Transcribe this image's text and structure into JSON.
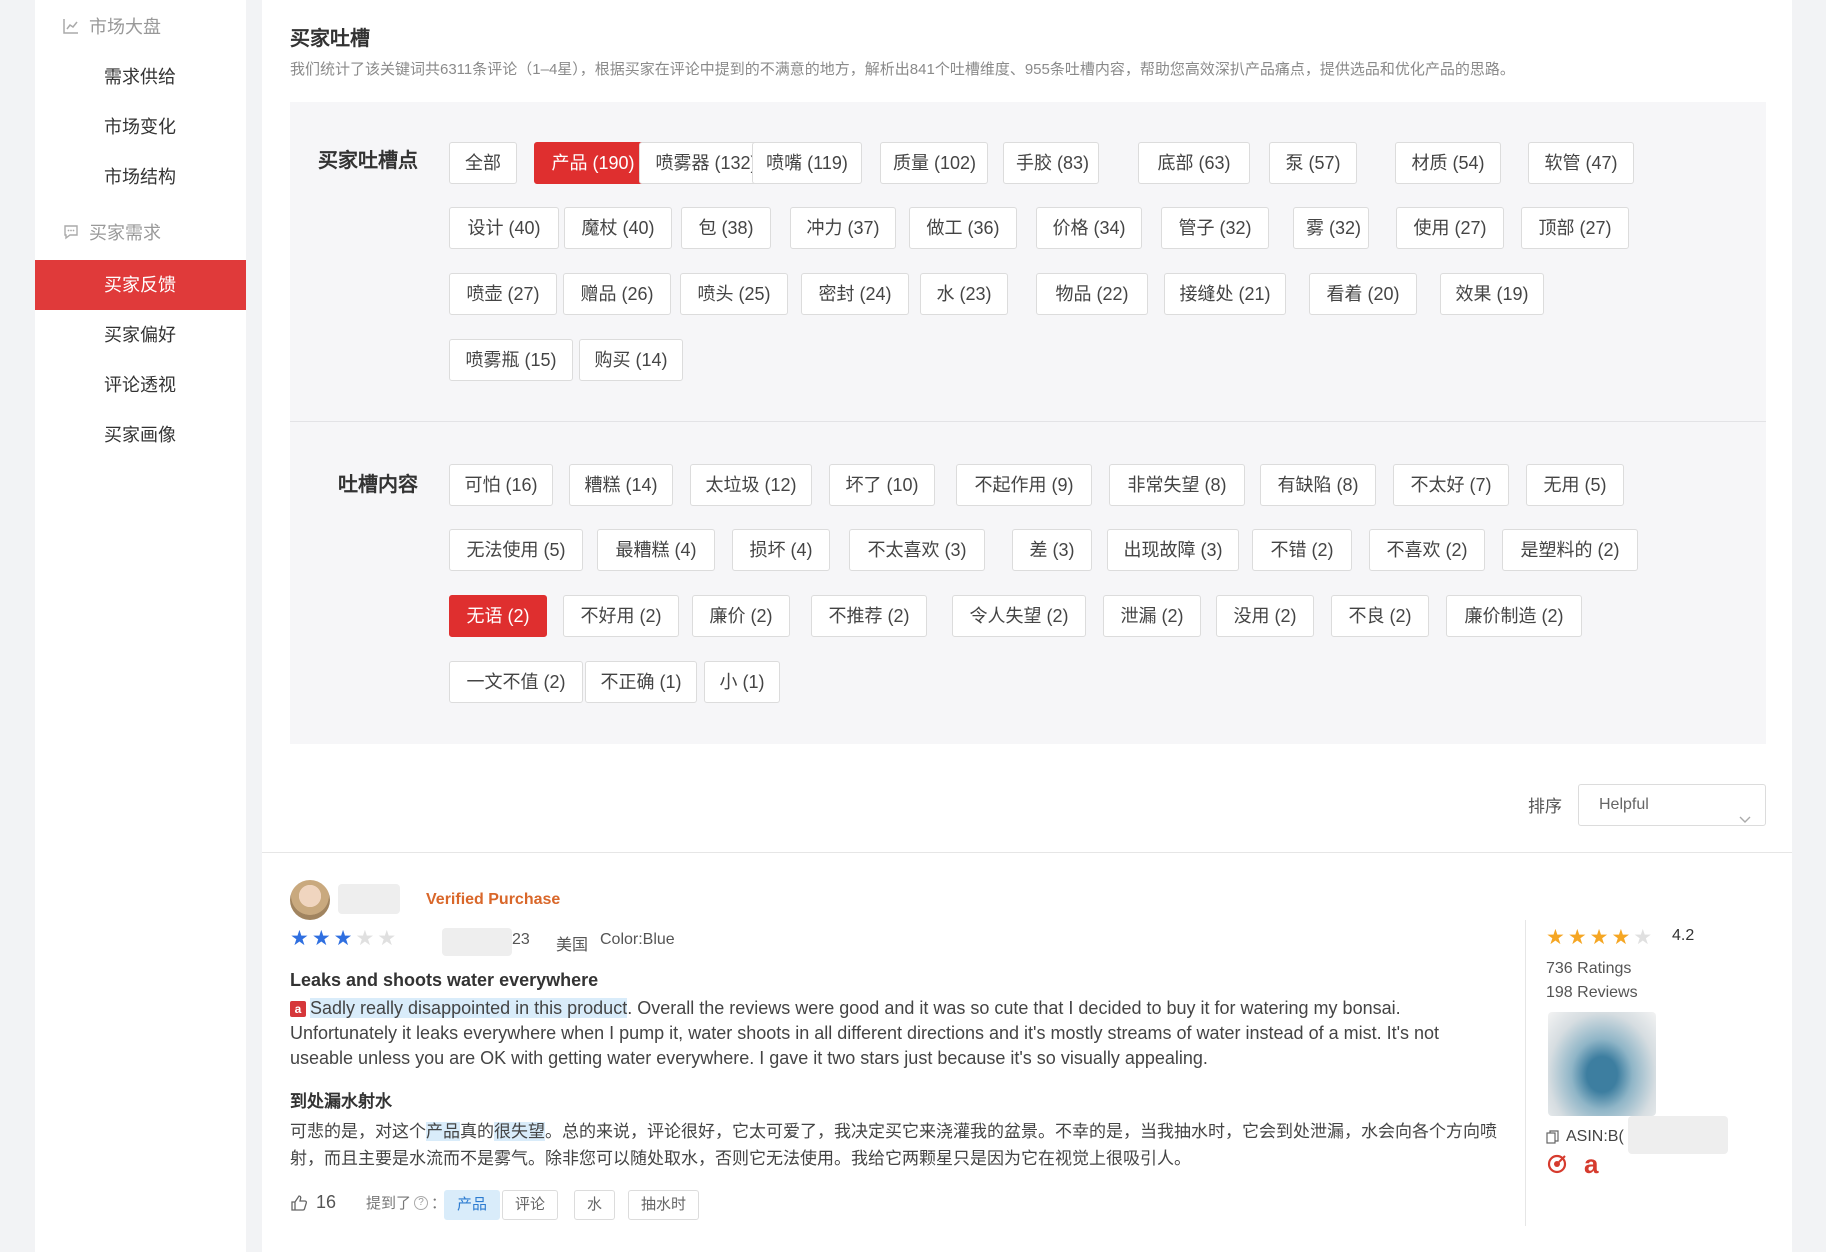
{
  "sidebar": {
    "sections": [
      {
        "label": "市场大盘",
        "icon": "chart-icon"
      },
      {
        "label": "买家需求",
        "icon": "chat-bubble-icon"
      }
    ],
    "market_items": [
      "需求供给",
      "市场变化",
      "市场结构"
    ],
    "buyer_items": [
      "买家反馈",
      "买家偏好",
      "评论透视",
      "买家画像"
    ],
    "active_item": "买家反馈"
  },
  "header": {
    "title": "买家吐槽",
    "description": "我们统计了该关键词共6311条评论（1–4星），根据买家在评论中提到的不满意的地方，解析出841个吐槽维度、955条吐槽内容，帮助您高效深扒产品痛点，提供选品和优化产品的思路。"
  },
  "complaint_points": {
    "label": "买家吐槽点",
    "selected": "产品 (190)",
    "tags": [
      "全部",
      "产品 (190)",
      "喷雾器 (132)",
      "喷嘴 (119)",
      "质量 (102)",
      "手胶 (83)",
      "底部 (63)",
      "泵 (57)",
      "材质 (54)",
      "软管 (47)",
      "设计 (40)",
      "魔杖 (40)",
      "包 (38)",
      "冲力 (37)",
      "做工 (36)",
      "价格 (34)",
      "管子 (32)",
      "雾 (32)",
      "使用 (27)",
      "顶部 (27)",
      "喷壶 (27)",
      "赠品 (26)",
      "喷头 (25)",
      "密封 (24)",
      "水 (23)",
      "物品 (22)",
      "接缝处 (21)",
      "看着 (20)",
      "效果 (19)",
      "喷雾瓶 (15)",
      "购买 (14)"
    ]
  },
  "complaint_content": {
    "label": "吐槽内容",
    "selected": "无语 (2)",
    "tags": [
      "可怕 (16)",
      "糟糕 (14)",
      "太垃圾 (12)",
      "坏了 (10)",
      "不起作用 (9)",
      "非常失望 (8)",
      "有缺陷 (8)",
      "不太好 (7)",
      "无用 (5)",
      "无法使用 (5)",
      "最糟糕 (4)",
      "损坏 (4)",
      "不太喜欢 (3)",
      "差 (3)",
      "出现故障 (3)",
      "不错 (2)",
      "不喜欢 (2)",
      "是塑料的 (2)",
      "无语 (2)",
      "不好用 (2)",
      "廉价 (2)",
      "不推荐 (2)",
      "令人失望 (2)",
      "泄漏 (2)",
      "没用 (2)",
      "不良 (2)",
      "廉价制造 (2)",
      "一文不值 (2)",
      "不正确 (1)",
      "小 (1)"
    ]
  },
  "sort": {
    "label": "排序",
    "value": "Helpful"
  },
  "review": {
    "verified": "Verified Purchase",
    "stars": 3,
    "date_partial": "23",
    "country": "美国",
    "color": "Color:Blue",
    "title": "Leaks and shoots water everywhere",
    "body_highlight": "Sadly really disappointed in this product",
    "body_rest": ". Overall the reviews were good and it was so cute that I decided to buy it for watering my bonsai. Unfortunately it leaks everywhere when I pump it, water shoots in all different directions and it's mostly streams of water instead of a mist. It's not useable unless you are OK with getting water everywhere. I gave it two stars just because it's so visually appealing.",
    "cn_title": "到处漏水射水",
    "cn_body_pre": "可悲的是，对这个",
    "cn_hl1": "产品",
    "cn_mid": "真的",
    "cn_hl2": "很失望",
    "cn_body_post": "。总的来说，评论很好，它太可爱了，我决定买它来浇灌我的盆景。不幸的是，当我抽水时，它会到处泄漏，水会向各个方向喷射，而且主要是水流而不是雾气。除非您可以随处取水，否则它无法使用。我给它两颗星只是因为它在视觉上很吸引人。",
    "likes": "16",
    "mentioned_label": "提到了",
    "mentioned_tags": [
      "产品",
      "评论",
      "水",
      "抽水时"
    ]
  },
  "product": {
    "rating": "4.2",
    "stars": 4,
    "ratings": "736 Ratings",
    "reviews": "198 Reviews",
    "asin_label": "ASIN:B("
  },
  "colors": {
    "accent_red": "#df2f2f",
    "verified_orange": "#d9672a",
    "star_blue": "#2f6fe0",
    "star_orange": "#f5a623",
    "highlight_blue": "#d9ecfa"
  }
}
